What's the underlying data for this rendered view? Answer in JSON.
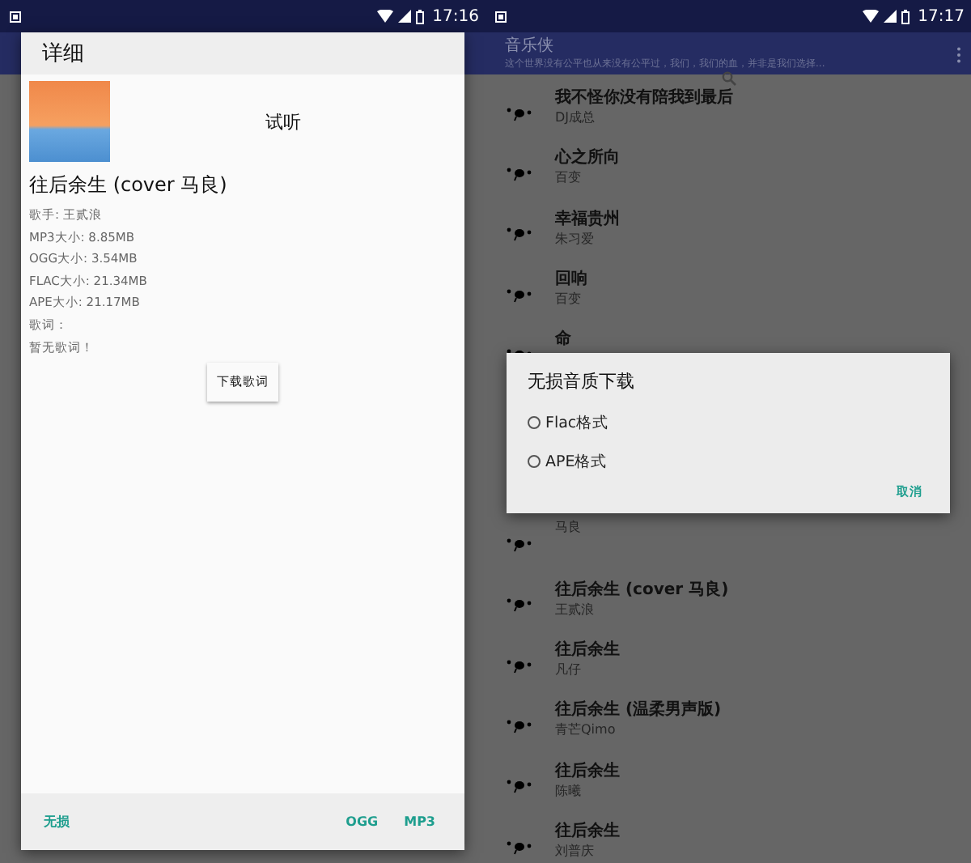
{
  "left_screen": {
    "status_bar": {
      "time": "17:16"
    },
    "detail_dialog": {
      "title": "详细",
      "preview_label": "试听",
      "song_title": "往后余生 (cover 马良)",
      "details": [
        "歌手: 王贰浪",
        "MP3大小: 8.85MB",
        "OGG大小: 3.54MB",
        "FLAC大小: 21.34MB",
        "APE大小: 21.17MB",
        "歌词：",
        "暂无歌词！"
      ],
      "lyrics_button": "下载歌词",
      "footer_left": "无损",
      "footer_right": [
        "OGG",
        "MP3"
      ]
    }
  },
  "right_screen": {
    "status_bar": {
      "time": "17:17"
    },
    "app_bar": {
      "title": "音乐侠",
      "subtitle": "这个世界没有公平也从来没有公平过，我们，我们的血，并非是我们选择..."
    },
    "songs_above": [
      {
        "title": "我不怪你没有陪我到最后",
        "artist": "DJ成总"
      },
      {
        "title": "心之所向",
        "artist": "百变"
      },
      {
        "title": "幸福贵州",
        "artist": "朱习爱"
      },
      {
        "title": "回响",
        "artist": "百变"
      },
      {
        "title": "命"
      }
    ],
    "songs_below": [
      {
        "artist": "马良"
      },
      {
        "title": "往后余生 (cover 马良)",
        "artist": "王贰浪"
      },
      {
        "title": "往后余生",
        "artist": "凡仔"
      },
      {
        "title": "往后余生 (温柔男声版)",
        "artist": "青芒Qimo"
      },
      {
        "title": "往后余生",
        "artist": "陈曦"
      },
      {
        "title": "往后余生",
        "artist": "刘普庆"
      }
    ],
    "format_dialog": {
      "title": "无损音质下载",
      "options": [
        {
          "label": "Flac格式",
          "selected": false
        },
        {
          "label": "APE格式",
          "selected": false
        }
      ],
      "cancel": "取消"
    }
  }
}
